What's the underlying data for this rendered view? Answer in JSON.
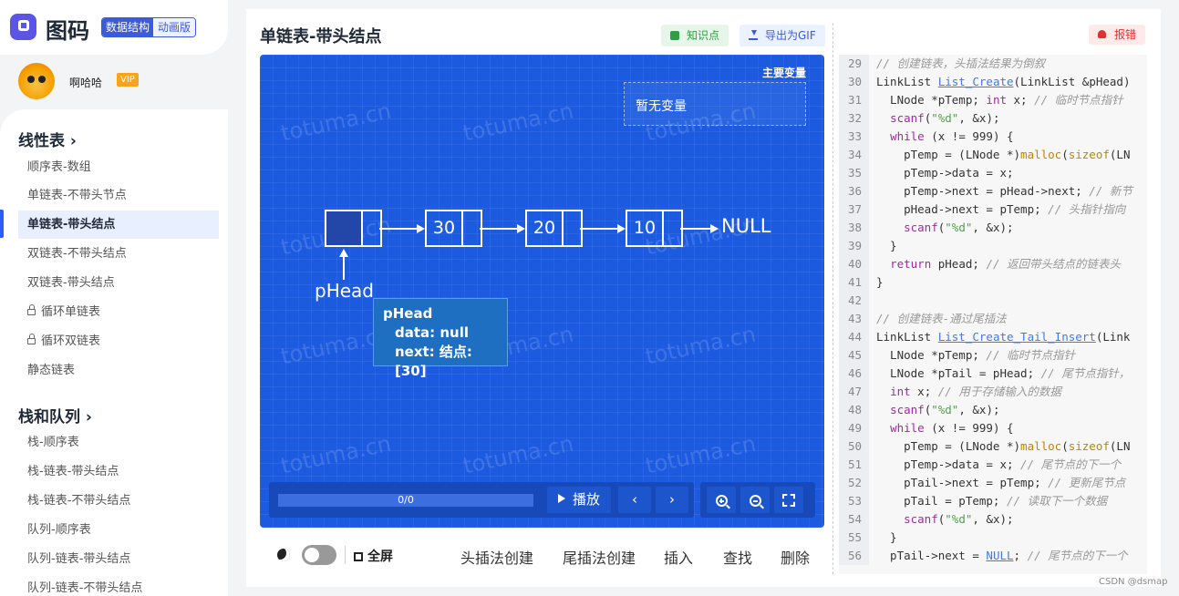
{
  "brand": {
    "name": "图码",
    "badge_a": "数据结构",
    "badge_b": "动画版"
  },
  "user": {
    "name": "啊哈哈",
    "vip": "VIP"
  },
  "sidebar": {
    "sections": [
      {
        "title": "线性表 ›"
      },
      {
        "title": "栈和队列 ›"
      }
    ],
    "items": [
      {
        "label": "顺序表-数组"
      },
      {
        "label": "单链表-不带头节点"
      },
      {
        "label": "单链表-带头结点"
      },
      {
        "label": "双链表-不带头结点"
      },
      {
        "label": "双链表-带头结点"
      },
      {
        "label": "循环单链表"
      },
      {
        "label": "循环双链表"
      },
      {
        "label": "静态链表"
      },
      {
        "label": "栈-顺序表"
      },
      {
        "label": "栈-链表-带头结点"
      },
      {
        "label": "栈-链表-不带头结点"
      },
      {
        "label": "队列-顺序表"
      },
      {
        "label": "队列-链表-带头结点"
      },
      {
        "label": "队列-链表-不带头结点"
      }
    ]
  },
  "main": {
    "title": "单链表-带头结点",
    "btn_knowledge": "知识点",
    "btn_export": "导出为GIF",
    "btn_report": "报错"
  },
  "canvas": {
    "watermark": "totuma.cn",
    "vars_title": "主要变量",
    "vars_empty": "暂无变量",
    "nodes": [
      "",
      "30",
      "20",
      "10"
    ],
    "null_label": "NULL",
    "head_pointer": "pHead",
    "tooltip": {
      "title": "pHead",
      "data": "data: null",
      "next": "next: 结点: [30]"
    },
    "progress": "0/0",
    "play": "播放",
    "prev": "‹",
    "next": "›"
  },
  "bottom": {
    "fullscreen": "全屏",
    "ops": [
      "头插法创建",
      "尾插法创建",
      "插入",
      "查找",
      "删除"
    ]
  },
  "code": [
    {
      "n": "29",
      "t": [
        [
          "cm",
          "// 创建链表，头插法结果为倒叙"
        ]
      ]
    },
    {
      "n": "30",
      "t": [
        [
          "",
          "LinkList "
        ],
        [
          "fn",
          "List_Create"
        ],
        [
          "",
          "(LinkList &pHead)"
        ]
      ]
    },
    {
      "n": "31",
      "t": [
        [
          "",
          "  LNode *pTemp; "
        ],
        [
          "kw",
          "int"
        ],
        [
          "",
          " x; "
        ],
        [
          "cm",
          "// 临时节点指针"
        ]
      ]
    },
    {
      "n": "32",
      "t": [
        [
          "",
          "  "
        ],
        [
          "kw",
          "scanf"
        ],
        [
          "",
          "("
        ],
        [
          "st",
          "\"%d\""
        ],
        [
          "",
          ", &x);"
        ]
      ]
    },
    {
      "n": "33",
      "t": [
        [
          "",
          "  "
        ],
        [
          "kw",
          "while"
        ],
        [
          "",
          " (x != 999) {"
        ]
      ]
    },
    {
      "n": "34",
      "t": [
        [
          "",
          "    pTemp = (LNode *)"
        ],
        [
          "fc",
          "malloc"
        ],
        [
          "",
          "("
        ],
        [
          "fc",
          "sizeof"
        ],
        [
          "",
          "(LN"
        ]
      ]
    },
    {
      "n": "35",
      "t": [
        [
          "",
          "    pTemp->data = x;"
        ]
      ]
    },
    {
      "n": "36",
      "t": [
        [
          "",
          "    pTemp->next = pHead->next; "
        ],
        [
          "cm",
          "// 新节"
        ]
      ]
    },
    {
      "n": "37",
      "t": [
        [
          "",
          "    pHead->next = pTemp; "
        ],
        [
          "cm",
          "// 头指针指向"
        ]
      ]
    },
    {
      "n": "38",
      "t": [
        [
          "",
          "    "
        ],
        [
          "kw",
          "scanf"
        ],
        [
          "",
          "("
        ],
        [
          "st",
          "\"%d\""
        ],
        [
          "",
          ", &x);"
        ]
      ]
    },
    {
      "n": "39",
      "t": [
        [
          "",
          "  }"
        ]
      ]
    },
    {
      "n": "40",
      "t": [
        [
          "",
          "  "
        ],
        [
          "kw",
          "return"
        ],
        [
          "",
          " pHead; "
        ],
        [
          "cm",
          "// 返回带头结点的链表头"
        ]
      ]
    },
    {
      "n": "41",
      "t": [
        [
          "",
          "}"
        ]
      ]
    },
    {
      "n": "42",
      "t": [
        [
          "",
          ""
        ]
      ]
    },
    {
      "n": "43",
      "t": [
        [
          "cm",
          "// 创建链表-通过尾插法"
        ]
      ]
    },
    {
      "n": "44",
      "t": [
        [
          "",
          "LinkList "
        ],
        [
          "fn",
          "List_Create_Tail_Insert"
        ],
        [
          "",
          "(Link"
        ]
      ]
    },
    {
      "n": "45",
      "t": [
        [
          "",
          "  LNode *pTemp; "
        ],
        [
          "cm",
          "// 临时节点指针"
        ]
      ]
    },
    {
      "n": "46",
      "t": [
        [
          "",
          "  LNode *pTail = pHead; "
        ],
        [
          "cm",
          "// 尾节点指针，"
        ]
      ]
    },
    {
      "n": "47",
      "t": [
        [
          "",
          "  "
        ],
        [
          "kw",
          "int"
        ],
        [
          "",
          " x; "
        ],
        [
          "cm",
          "// 用于存储输入的数据"
        ]
      ]
    },
    {
      "n": "48",
      "t": [
        [
          "",
          "  "
        ],
        [
          "kw",
          "scanf"
        ],
        [
          "",
          "("
        ],
        [
          "st",
          "\"%d\""
        ],
        [
          "",
          ", &x);"
        ]
      ]
    },
    {
      "n": "49",
      "t": [
        [
          "",
          "  "
        ],
        [
          "kw",
          "while"
        ],
        [
          "",
          " (x != 999) {"
        ]
      ]
    },
    {
      "n": "50",
      "t": [
        [
          "",
          "    pTemp = (LNode *)"
        ],
        [
          "fc",
          "malloc"
        ],
        [
          "",
          "("
        ],
        [
          "fc",
          "sizeof"
        ],
        [
          "",
          "(LN"
        ]
      ]
    },
    {
      "n": "51",
      "t": [
        [
          "",
          "    pTemp->data = x; "
        ],
        [
          "cm",
          "// 尾节点的下一个"
        ]
      ]
    },
    {
      "n": "52",
      "t": [
        [
          "",
          "    pTail->next = pTemp; "
        ],
        [
          "cm",
          "// 更新尾节点"
        ]
      ]
    },
    {
      "n": "53",
      "t": [
        [
          "",
          "    pTail = pTemp; "
        ],
        [
          "cm",
          "// 读取下一个数据"
        ]
      ]
    },
    {
      "n": "54",
      "t": [
        [
          "",
          "    "
        ],
        [
          "kw",
          "scanf"
        ],
        [
          "",
          "("
        ],
        [
          "st",
          "\"%d\""
        ],
        [
          "",
          ", &x);"
        ]
      ]
    },
    {
      "n": "55",
      "t": [
        [
          "",
          "  }"
        ]
      ]
    },
    {
      "n": "56",
      "t": [
        [
          "",
          "  pTail->next = "
        ],
        [
          "fn",
          "NULL"
        ],
        [
          "",
          "; "
        ],
        [
          "cm",
          "// 尾节点的下一个"
        ]
      ]
    }
  ],
  "footer": "CSDN @dsmap"
}
